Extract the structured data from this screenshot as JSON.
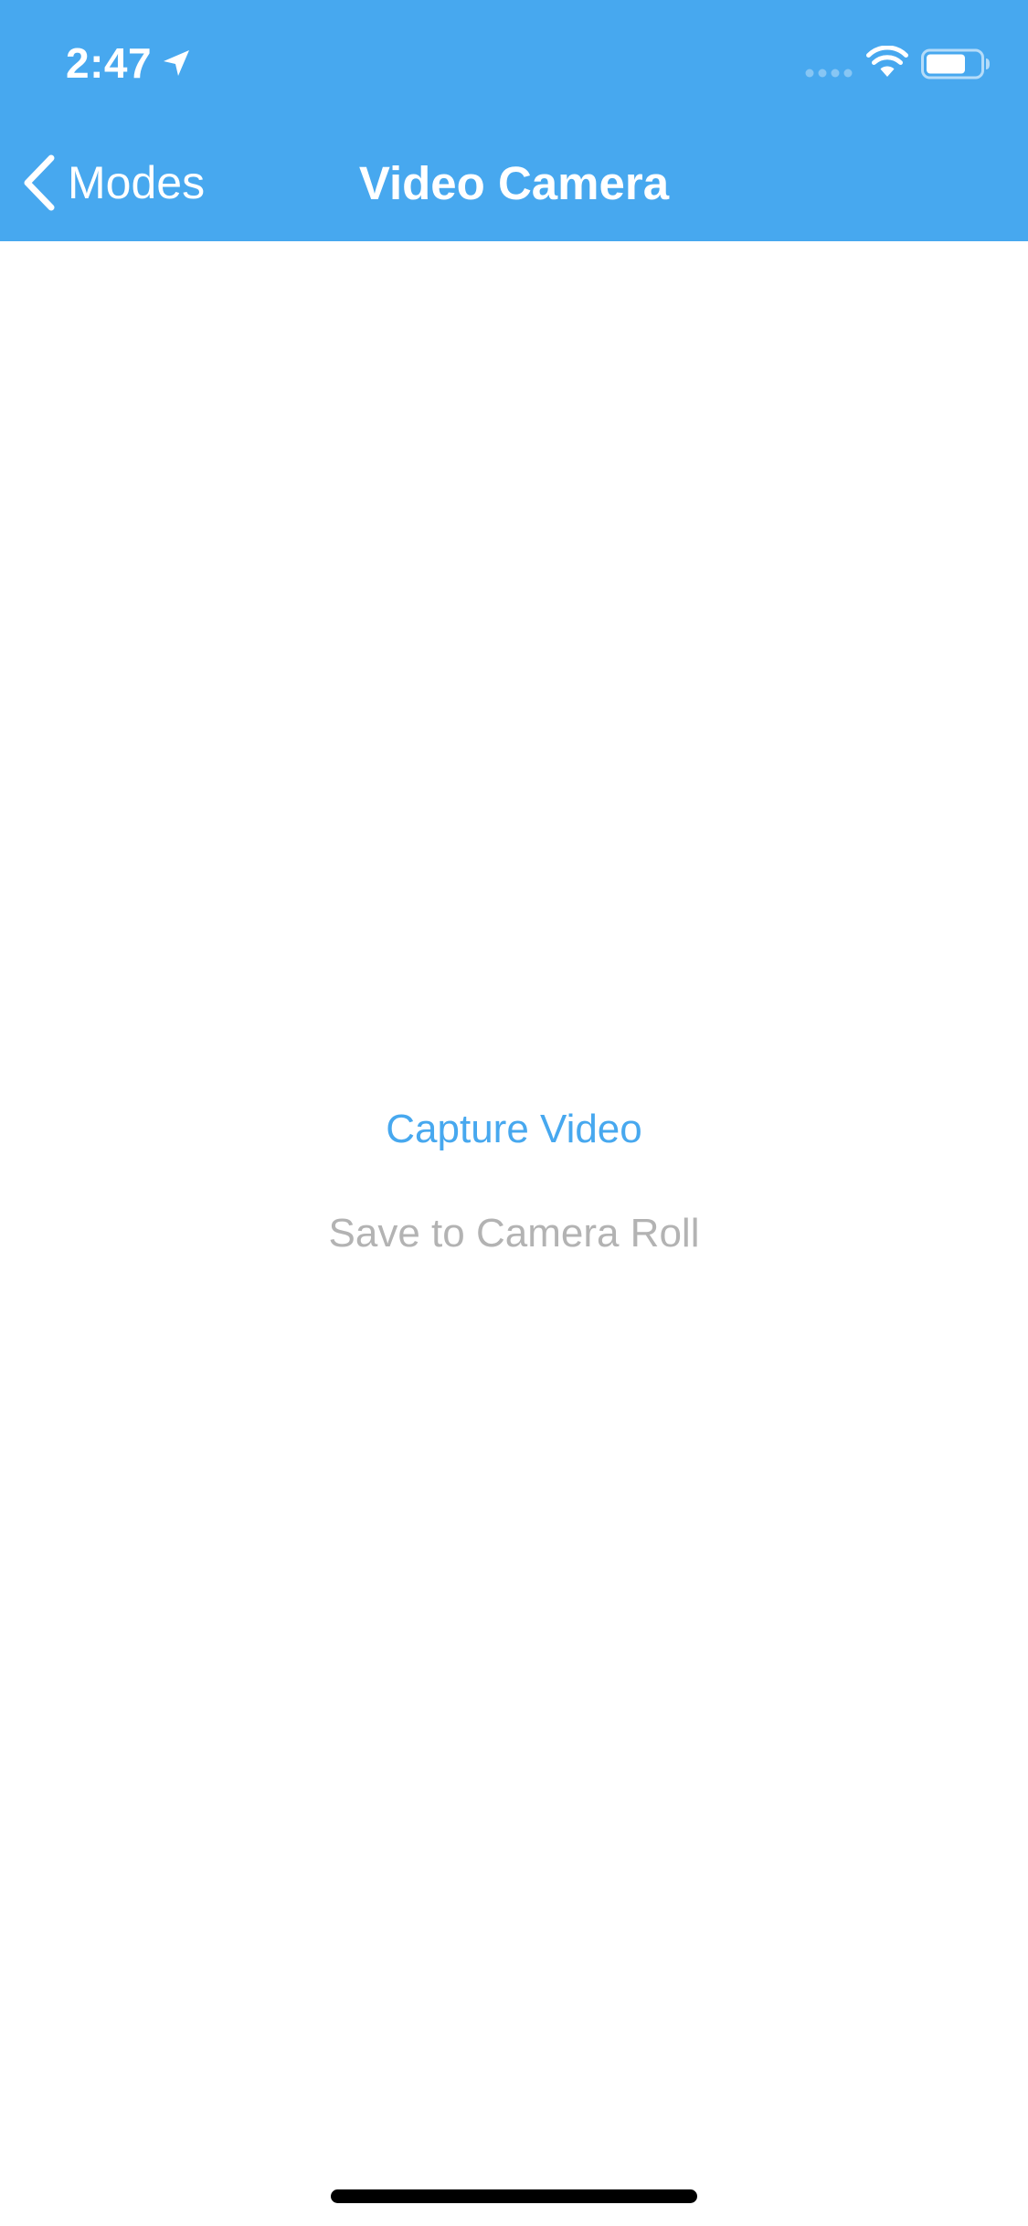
{
  "status_bar": {
    "time": "2:47",
    "location_icon": "location-arrow-icon",
    "signal_icon": "cellular-signal-icon",
    "wifi_icon": "wifi-icon",
    "battery_icon": "battery-icon"
  },
  "nav_bar": {
    "back_label": "Modes",
    "back_icon": "chevron-left-icon",
    "title": "Video Camera"
  },
  "actions": {
    "capture_label": "Capture Video",
    "save_label": "Save to Camera Roll",
    "save_state": "disabled"
  },
  "colors": {
    "header_bg": "#47A8EF",
    "accent": "#47A8EF",
    "disabled_text": "#B3B3B3",
    "background": "#FFFFFF"
  }
}
